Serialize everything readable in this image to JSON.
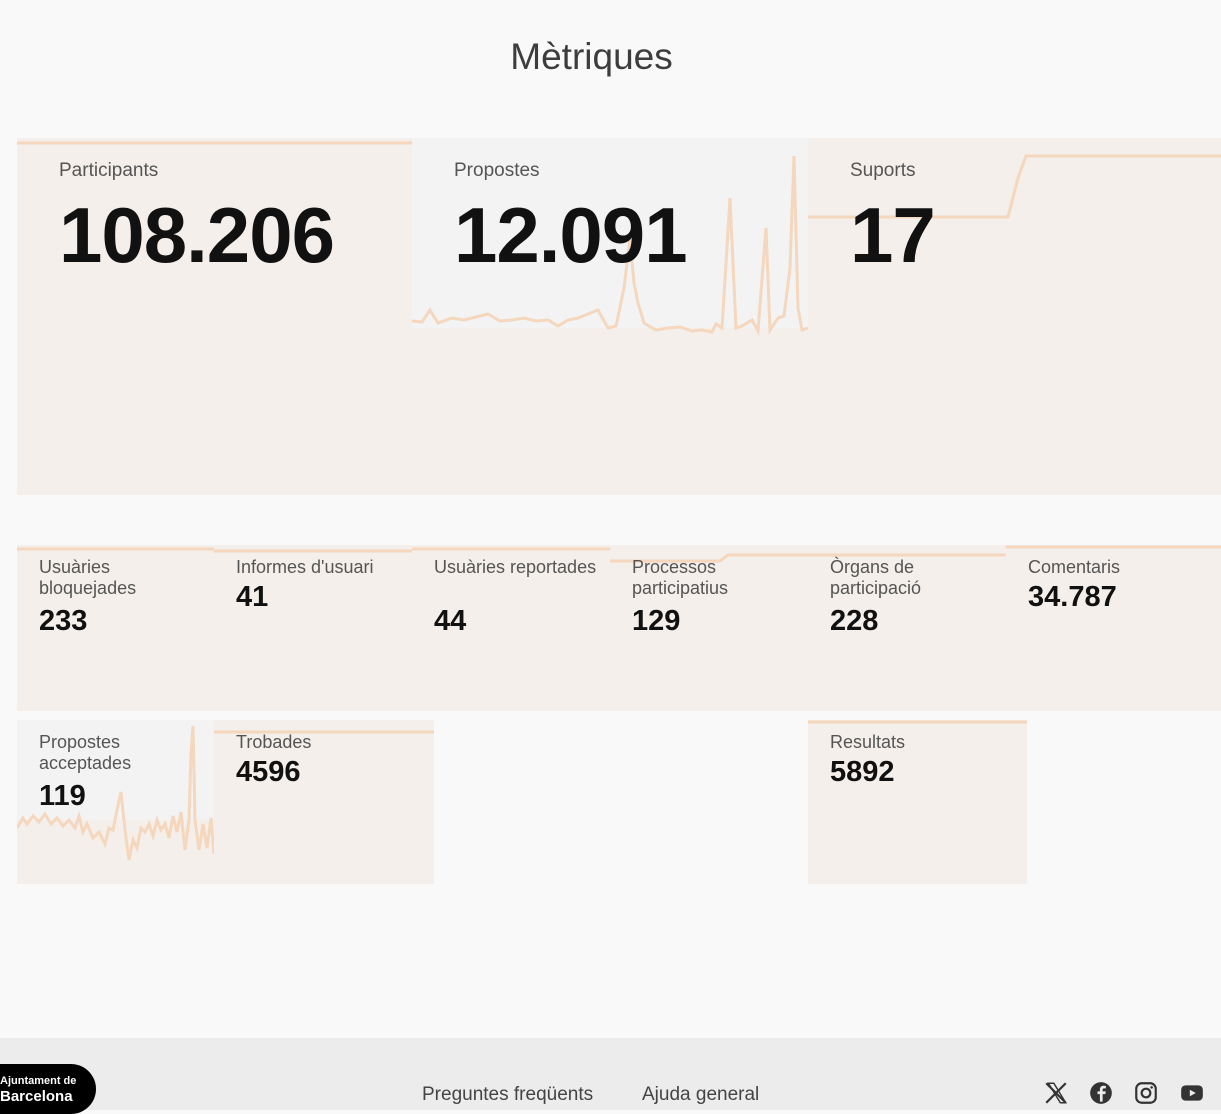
{
  "page": {
    "title": "Mètriques"
  },
  "colors": {
    "accent": "#f5d7bd",
    "card_bg": "#f4efea",
    "card_gray": "#f3f3f3"
  },
  "main_metrics": [
    {
      "label": "Participants",
      "value": "108.206"
    },
    {
      "label": "Propostes",
      "value": "12.091"
    },
    {
      "label": "Suports",
      "value": "17"
    }
  ],
  "secondary_metrics": [
    {
      "label": "Usuàries bloquejades",
      "value": "233"
    },
    {
      "label": "Informes d'usuari",
      "value": "41"
    },
    {
      "label": "Usuàries reportades",
      "value": "44"
    },
    {
      "label": "Processos participatius",
      "value": "129"
    },
    {
      "label": "Òrgans de participació",
      "value": "228"
    },
    {
      "label": "Comentaris",
      "value": "34.787"
    },
    {
      "label": "Propostes acceptades",
      "value": "119"
    },
    {
      "label": "Trobades",
      "value": "4596"
    },
    {
      "label": "Resultats",
      "value": "5892"
    }
  ],
  "footer": {
    "logo_line1": "Ajuntament de",
    "logo_line2": "Barcelona",
    "links": [
      "Preguntes freqüents",
      "Ajuda general"
    ],
    "social_icons": [
      "x-icon",
      "facebook-icon",
      "instagram-icon",
      "youtube-icon"
    ]
  }
}
